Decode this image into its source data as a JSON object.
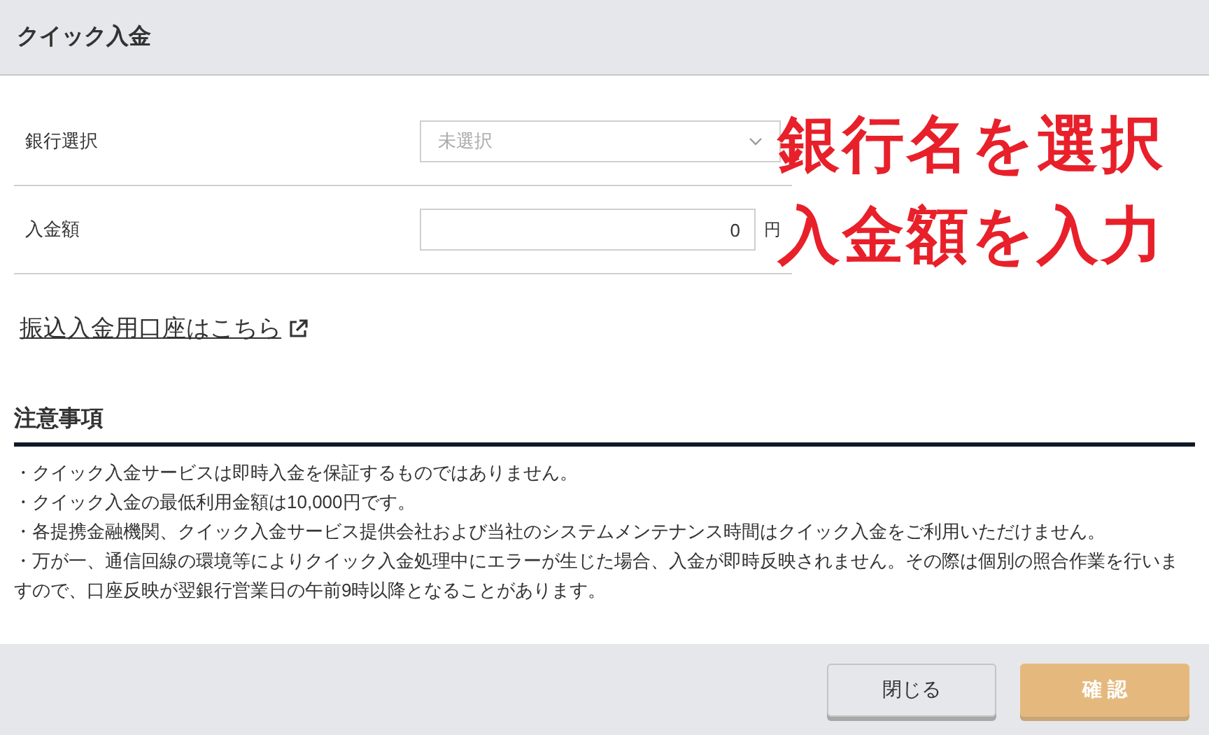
{
  "window": {
    "title": "クイック入金"
  },
  "form": {
    "rows": [
      {
        "kind": "select",
        "label": "銀行選択",
        "placeholder": "未選択"
      },
      {
        "kind": "amount",
        "label": "入金額",
        "value": "0",
        "unit": "円"
      }
    ]
  },
  "link": {
    "label": "振込入金用口座はこちら"
  },
  "notes": {
    "title": "注意事項",
    "items": [
      "・クイック入金サービスは即時入金を保証するものではありません。",
      "・クイック入金の最低利用金額は10,000円です。",
      "・各提携金融機関、クイック入金サービス提供会社および当社のシステムメンテナンス時間はクイック入金をご利用いただけません。",
      "・万が一、通信回線の環境等によりクイック入金処理中にエラーが生じた場合、入金が即時反映されません。その際は個別の照合作業を行いますので、口座反映が翌銀行営業日の午前9時以降となることがあります。"
    ]
  },
  "annotations": [
    "銀行名を選択",
    "入金額を入力"
  ],
  "buttons": [
    {
      "label": "閉じる",
      "kind": "secondary",
      "disabled": false
    },
    {
      "label": "確 認",
      "kind": "primary",
      "disabled": true
    }
  ]
}
